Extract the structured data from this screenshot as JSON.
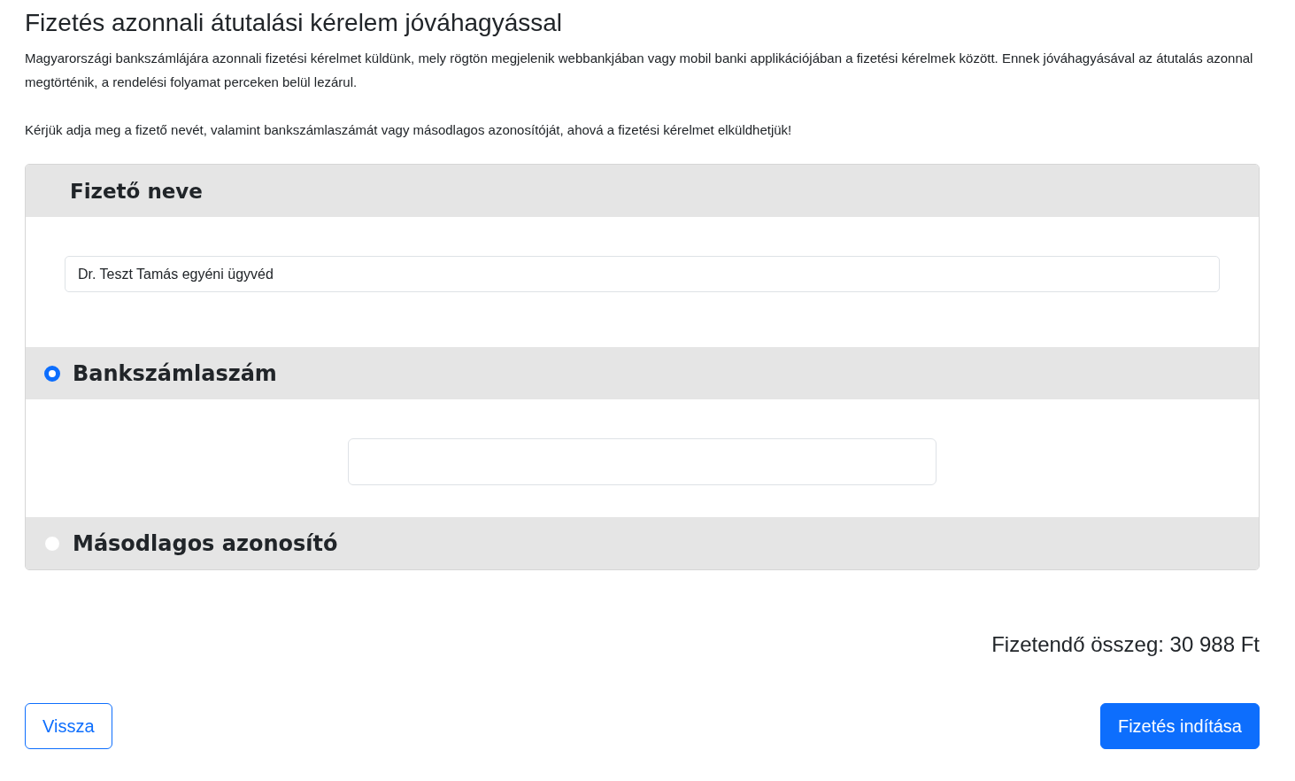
{
  "title": "Fizetés azonnali átutalási kérelem jóváhagyással",
  "intro": "Magyarországi bankszámlájára azonnali fizetési kérelmet küldünk, mely rögtön megjelenik webbankjában vagy mobil banki applikációjában a fizetési kérelmek között. Ennek jóváhagyásával az átutalás azonnal megtörténik, a rendelési folyamat perceken belül lezárul.",
  "instruction": "Kérjük adja meg a fizető nevét, valamint bankszámlaszámát vagy másodlagos azonosítóját, ahová a fizetési kérelmet elküldhetjük!",
  "payer": {
    "heading": "Fizető neve",
    "value": "Dr. Teszt Tamás egyéni ügyvéd"
  },
  "options": [
    {
      "label": "Bankszámlaszám",
      "selected": true
    },
    {
      "label": "Másodlagos azonosító",
      "selected": false
    }
  ],
  "amount": "Fizetendő összeg: 30 988 Ft",
  "buttons": [
    {
      "label": "Vissza",
      "kind": "secondary"
    },
    {
      "label": "Fizetés indítása",
      "kind": "primary"
    }
  ]
}
